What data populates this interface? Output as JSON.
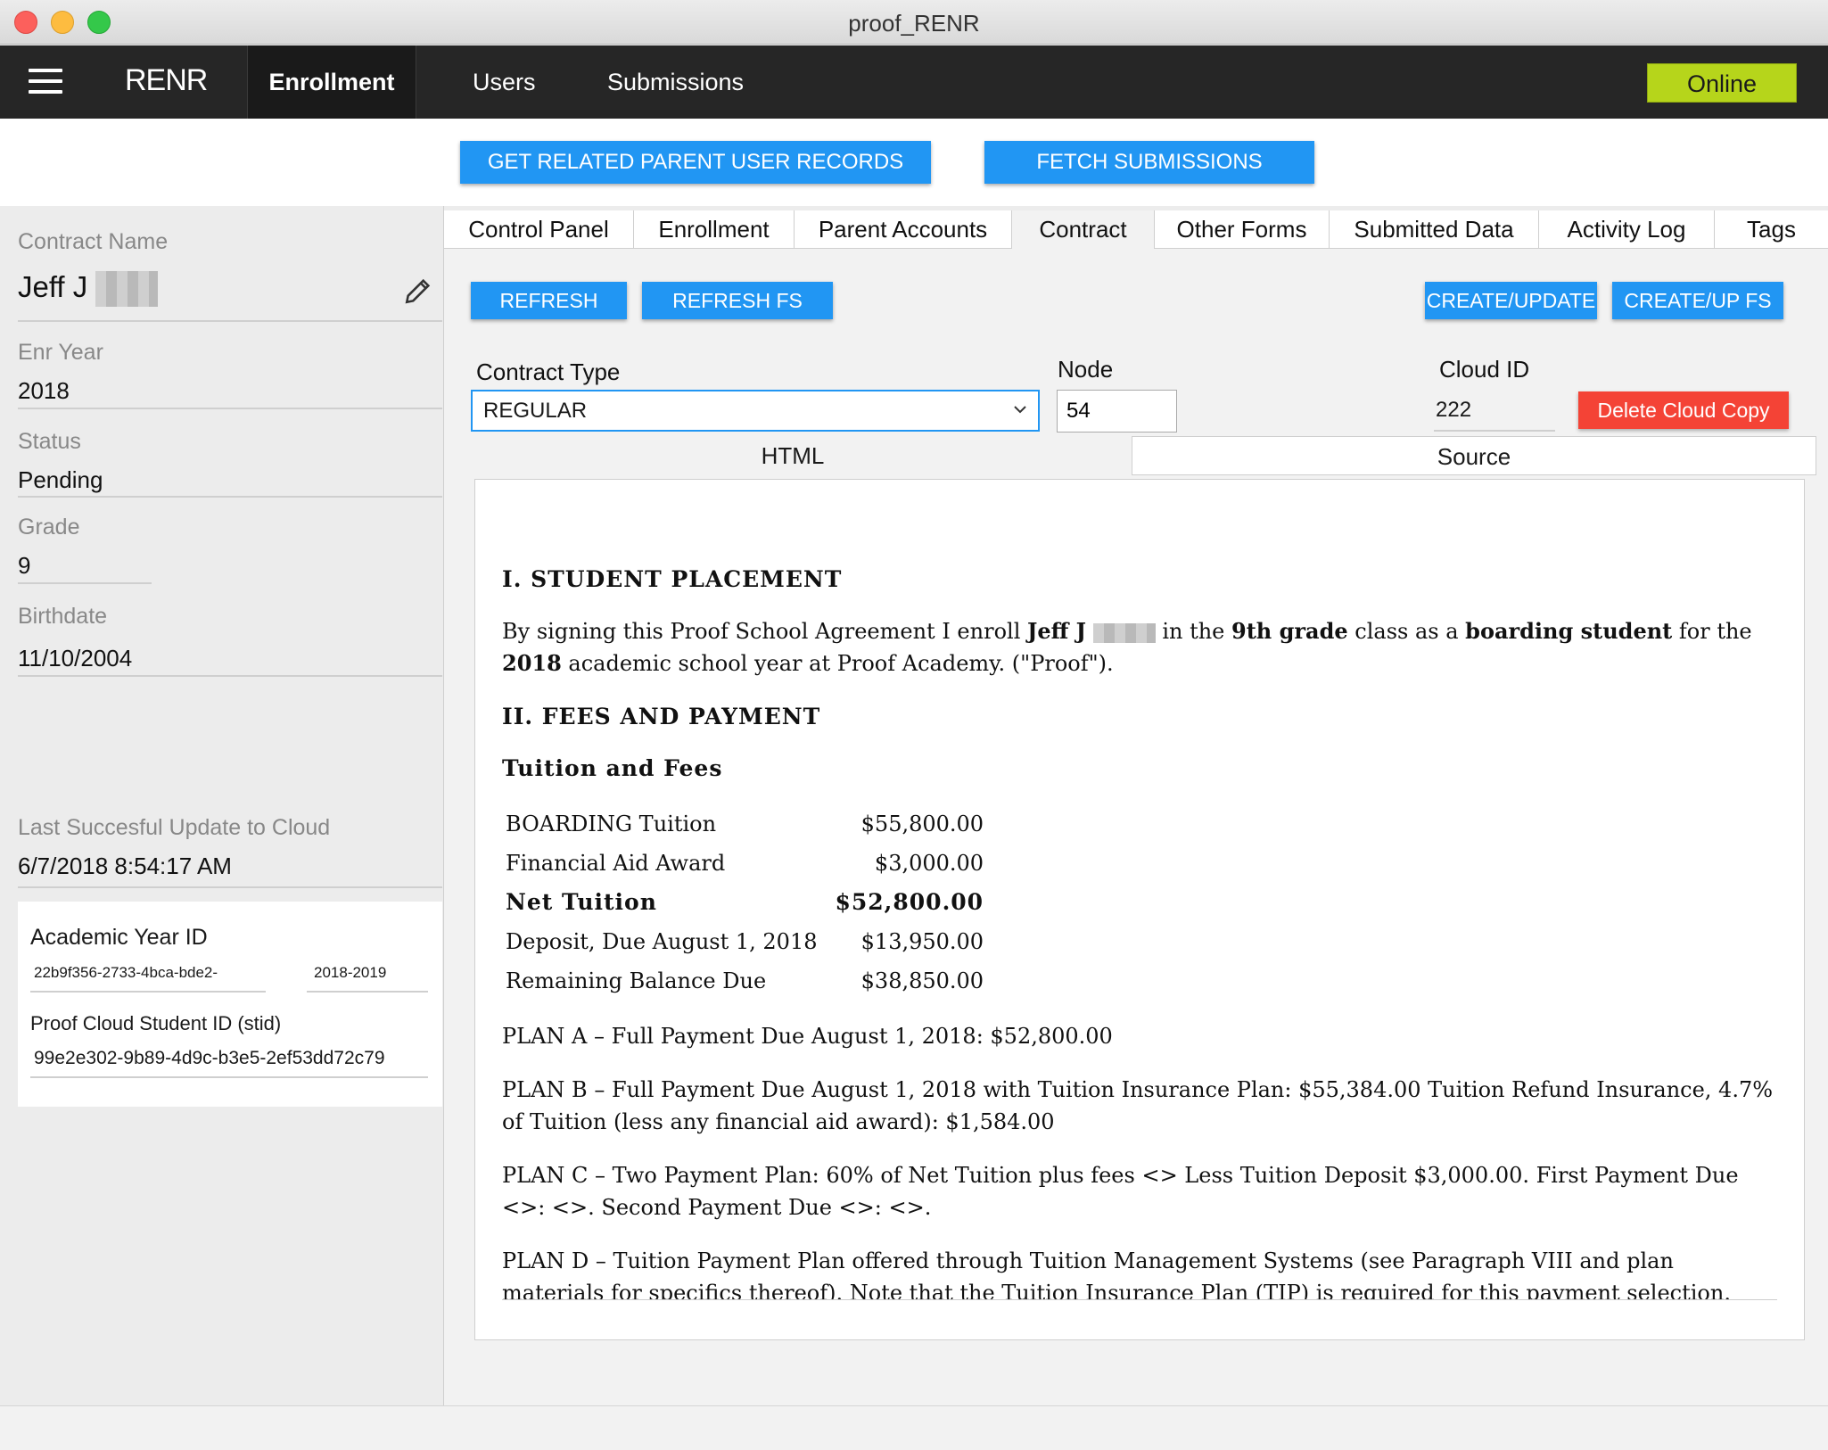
{
  "window": {
    "title": "proof_RENR"
  },
  "topnav": {
    "brand": "RENR",
    "tabs": [
      {
        "label": "Enrollment",
        "active": true
      },
      {
        "label": "Users"
      },
      {
        "label": "Submissions"
      }
    ],
    "status": "Online",
    "status_color": "#b6d51b"
  },
  "actions": {
    "get_parent_records": "GET RELATED PARENT USER RECORDS",
    "fetch_submissions": "FETCH SUBMISSIONS"
  },
  "sidebar": {
    "contract_name_label": "Contract Name",
    "contract_name_value": "Jeff J",
    "enr_year_label": "Enr Year",
    "enr_year_value": "2018",
    "status_label": "Status",
    "status_value": "Pending",
    "grade_label": "Grade",
    "grade_value": "9",
    "birthdate_label": "Birthdate",
    "birthdate_value": "11/10/2004",
    "last_update_label": "Last Succesful Update to Cloud",
    "last_update_value": "6/7/2018 8:54:17 AM",
    "card": {
      "academic_year_label": "Academic Year ID",
      "academic_year_id": "22b9f356-2733-4bca-bde2-",
      "academic_year_value": "2018-2019",
      "stid_label": "Proof Cloud Student ID (stid)",
      "stid_value": "99e2e302-9b89-4d9c-b3e5-2ef53dd72c79"
    }
  },
  "tabs": [
    {
      "label": "Control Panel"
    },
    {
      "label": "Enrollment"
    },
    {
      "label": "Parent Accounts"
    },
    {
      "label": "Contract",
      "active": true
    },
    {
      "label": "Other Forms"
    },
    {
      "label": "Submitted Data"
    },
    {
      "label": "Activity Log"
    },
    {
      "label": "Tags"
    }
  ],
  "contract": {
    "refresh": "REFRESH",
    "refresh_fs": "REFRESH FS",
    "create_update": "CREATE/UPDATE",
    "create_up_fs": "CREATE/UP FS",
    "contract_type_label": "Contract Type",
    "contract_type_value": "REGULAR",
    "node_label": "Node",
    "node_value": "54",
    "cloud_id_label": "Cloud ID",
    "cloud_id_value": "222",
    "delete_cloud_copy": "Delete Cloud Copy",
    "subtabs": [
      {
        "label": "HTML",
        "active": true
      },
      {
        "label": "Source"
      }
    ]
  },
  "document": {
    "section1_heading": "I. STUDENT PLACEMENT",
    "p1_a": "By signing this Proof School Agreement I enroll ",
    "p1_name": "Jeff J",
    "p1_b": " in the ",
    "p1_grade": "9th grade",
    "p1_c": " class as a ",
    "p1_type": "boarding student",
    "p1_d": " for the ",
    "p1_year": "2018",
    "p1_e": " academic school year at Proof Academy. (\"Proof\").",
    "section2_heading": "II. FEES AND PAYMENT",
    "tuition_heading": "Tuition and Fees",
    "fees": [
      {
        "label": "BOARDING Tuition",
        "amount": "$55,800.00"
      },
      {
        "label": "Financial Aid Award",
        "amount": "$3,000.00"
      },
      {
        "label": "Net Tuition",
        "amount": "$52,800.00",
        "bold": true
      },
      {
        "label": "Deposit, Due August 1, 2018",
        "amount": "$13,950.00"
      },
      {
        "label": "Remaining Balance Due",
        "amount": "$38,850.00"
      }
    ],
    "plan_a": "PLAN A – Full Payment Due August 1, 2018: $52,800.00",
    "plan_b": "PLAN B – Full Payment Due August 1, 2018 with Tuition Insurance Plan: $55,384.00 Tuition Refund Insurance, 4.7% of Tuition (less any financial aid award): $1,584.00",
    "plan_c": "PLAN C – Two Payment Plan: 60% of Net Tuition plus fees <> Less Tuition Deposit $3,000.00. First Payment Due <>: <>. Second Payment Due <>: <>.",
    "plan_d": "PLAN D – Tuition Payment Plan offered through Tuition Management Systems (see Paragraph VIII and plan materials for specifics thereof). Note that the Tuition Insurance Plan (TIP) is required for this payment selection. The"
  }
}
